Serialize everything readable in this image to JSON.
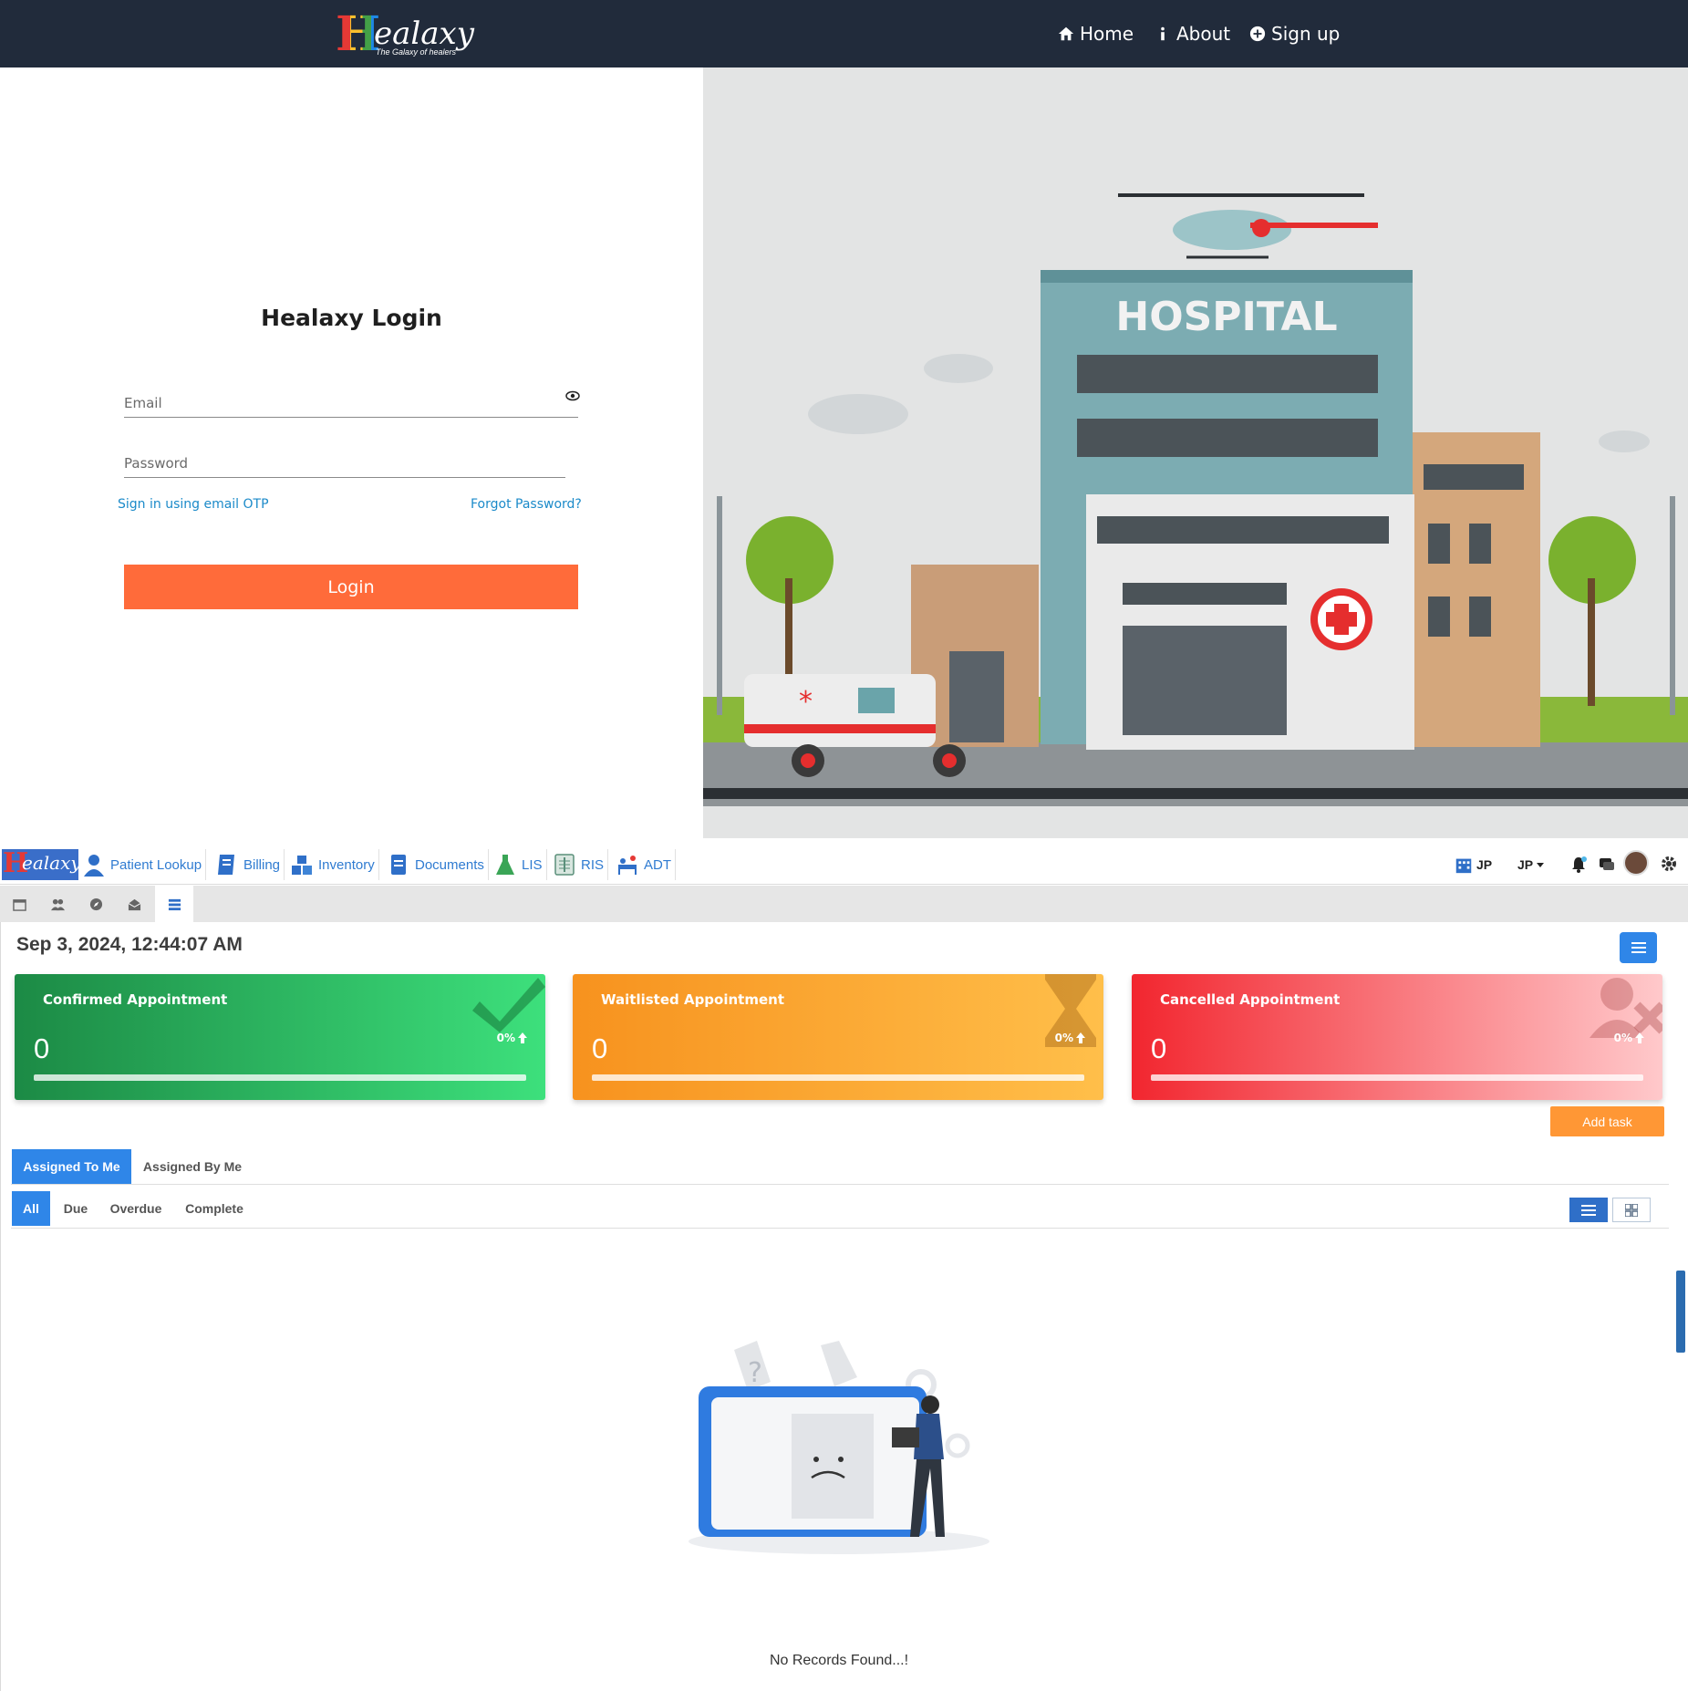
{
  "top_nav": {
    "logo_letter": "H",
    "logo_text": "ealaxy",
    "logo_tagline": "The Galaxy of healers",
    "links": [
      {
        "label": "Home",
        "icon": "home-icon"
      },
      {
        "label": "About",
        "icon": "info-icon"
      },
      {
        "label": "Sign up",
        "icon": "plus-circle-icon"
      }
    ]
  },
  "login": {
    "title": "Healaxy Login",
    "email_placeholder": "Email",
    "password_placeholder": "Password",
    "otp_link": "Sign in using email OTP",
    "forgot_link": "Forgot Password?",
    "login_button": "Login"
  },
  "hero": {
    "sign_text": "HOSPITAL"
  },
  "app": {
    "logo_letter": "H",
    "logo_text": "ealaxy",
    "modules": [
      "Patient Lookup",
      "Billing",
      "Inventory",
      "Documents",
      "LIS",
      "RIS",
      "ADT"
    ],
    "org_code": "JP",
    "user_code": "JP",
    "datetime": "Sep 3, 2024, 12:44:07 AM",
    "cards": [
      {
        "label": "Confirmed Appointment",
        "count": "0",
        "percent": "0%",
        "colors": [
          "#1c8a45",
          "#3de07c"
        ]
      },
      {
        "label": "Waitlisted Appointment",
        "count": "0",
        "percent": "0%",
        "colors": [
          "#f7921e",
          "#ffbf4a"
        ]
      },
      {
        "label": "Cancelled Appointment",
        "count": "0",
        "percent": "0%",
        "colors": [
          "#f2262f",
          "#ffc9cb"
        ]
      }
    ],
    "add_task": "Add task",
    "assign_tabs": [
      "Assigned To Me",
      "Assigned By Me"
    ],
    "filter_tabs": [
      "All",
      "Due",
      "Overdue",
      "Complete"
    ],
    "empty_message": "No Records Found...!"
  },
  "colors": {
    "nav_bg": "#212b3b",
    "accent_orange": "#ff6b3a",
    "link_blue": "#1b8ac9",
    "tab_blue": "#2f86e8"
  }
}
